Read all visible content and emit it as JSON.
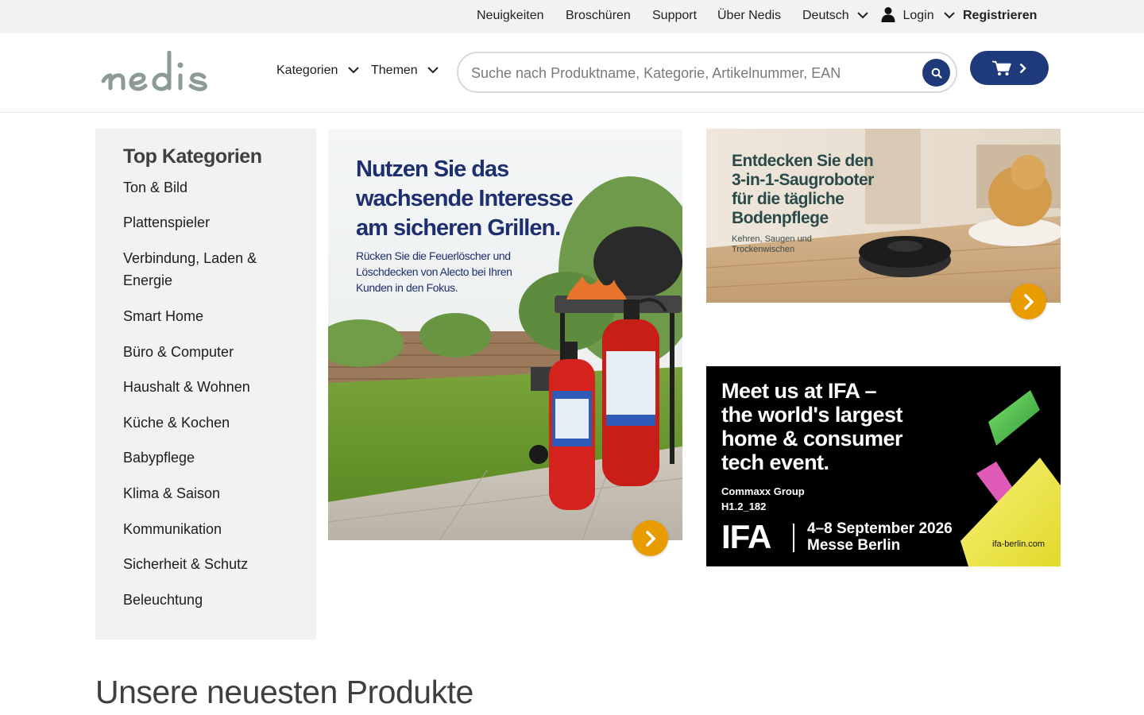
{
  "topbar": {
    "news": "Neuigkeiten",
    "brochures": "Broschüren",
    "support": "Support",
    "about": "Über Nedis",
    "language": "Deutsch",
    "login": "Login",
    "register": "Registrieren"
  },
  "header": {
    "nav_categories": "Kategorien",
    "nav_themes": "Themen",
    "search_placeholder": "Suche nach Produktname, Kategorie, Artikelnummer, EAN"
  },
  "sidebar": {
    "title": "Top Kategorien",
    "items": [
      "Ton & Bild",
      "Plattenspieler",
      "Verbindung, Laden & Energie",
      "Smart Home",
      "Büro & Computer",
      "Haushalt & Wohnen",
      "Küche & Kochen",
      "Babypflege",
      "Klima & Saison",
      "Kommunikation",
      "Sicherheit & Schutz",
      "Beleuchtung"
    ]
  },
  "banners": {
    "grill": {
      "headline": [
        "Nutzen Sie das",
        "wachsende Interesse",
        "am sicheren Grillen."
      ],
      "body": [
        "Rücken Sie die Feuerlöscher und",
        "Löschdecken von Alecto bei Ihren",
        "Kunden in den Fokus."
      ]
    },
    "robot": {
      "headline": [
        "Entdecken Sie den",
        "3-in-1-Saugroboter",
        "für die tägliche",
        "Bodenpflege"
      ],
      "sub": [
        "Kehren, Saugen und",
        "Trockenwischen"
      ]
    },
    "ifa": {
      "headline": [
        "Meet us at IFA –",
        "the world's largest",
        "home & consumer",
        "tech event."
      ],
      "group": "Commaxx Group",
      "booth": "H1.2_182",
      "logo": "IFA",
      "dates": "4–8 September 2026",
      "venue": "Messe Berlin",
      "url": "ifa-berlin.com"
    }
  },
  "main": {
    "newest_title": "Unsere neuesten Produkte"
  },
  "colors": {
    "brand_blue": "#1e3a7b",
    "accent_orange": "#e89c00",
    "logo_gray": "#8c9b94"
  }
}
